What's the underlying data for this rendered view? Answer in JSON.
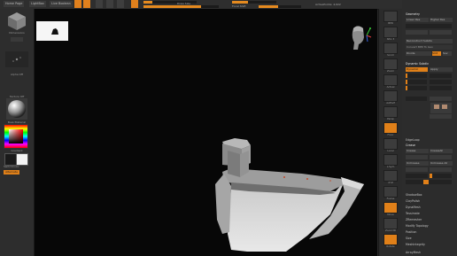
{
  "topbar": {
    "home_page": "Home Page",
    "lightbox": "LightBox",
    "live_boolean": "Live Boolean",
    "draw_size": "Draw Size",
    "focal_shift": "Focal Shift",
    "active_points": "ActivePoints: 4,622"
  },
  "left": {
    "cube_label": "Dimensions",
    "stroke_label": "AdCustom",
    "alpha_label": "Alpha Off",
    "material_label": "BasicMaterial",
    "texture_label": "Texture Off",
    "gradient_label": "Gradient",
    "switch_color": "SwitchColor",
    "alternate": "Alternate"
  },
  "rightcol": {
    "icons": [
      {
        "name": "bpr-icon",
        "label": "BPR"
      },
      {
        "name": "spix-icon",
        "label": "SPix 3"
      },
      {
        "name": "scroll-icon",
        "label": "Scroll"
      },
      {
        "name": "zoom-icon",
        "label": "Zoom"
      },
      {
        "name": "actual-icon",
        "label": "Actual"
      },
      {
        "name": "aahalf-icon",
        "label": "AAHalf"
      },
      {
        "name": "persp-icon",
        "label": "Persp"
      },
      {
        "name": "floor-icon",
        "label": "Floor"
      },
      {
        "name": "local-icon",
        "label": "Local"
      },
      {
        "name": "lsym-icon",
        "label": "L.Sym"
      },
      {
        "name": "xyz-icon",
        "label": "XYZ"
      },
      {
        "name": "frame-icon",
        "label": "Frame"
      },
      {
        "name": "move-icon",
        "label": "Move"
      },
      {
        "name": "zoom3d-icon",
        "label": "Zoom3D"
      },
      {
        "name": "rotate-icon",
        "label": "Rotate"
      },
      {
        "name": "linefill-icon",
        "label": "Line Fill PolyF"
      },
      {
        "name": "transp-icon",
        "label": "Transp"
      },
      {
        "name": "ghost-icon",
        "label": "Ghost"
      },
      {
        "name": "solo-icon",
        "label": "Solo"
      },
      {
        "name": "xpose-icon",
        "label": "Xpose"
      }
    ]
  },
  "rightpanel": {
    "geometry": "Geometry",
    "lower_res": "Lower Res",
    "higher_res": "Higher Res",
    "sdiv": "SDiv",
    "del_lower": "Del Lower",
    "del_higher": "Del Higher",
    "reconstruct_subdiv": "Reconstruct Subdiv",
    "convert_bpr": "Convert BPR To Geo",
    "divide": "Divide",
    "smt": "Smt",
    "suv": "Suv",
    "dynamic_subdiv": "Dynamic Subdiv",
    "dynamic": "Dynamic",
    "apply": "Apply",
    "qgrid": "QGrid 0",
    "coverage": "Coverage",
    "flat_subdiv": "Flat Subdiv",
    "smooth_subdiv": "Smooth Subdiv",
    "micropoly": "MicroPoly Off",
    "edgeloop": "EdgeLoop",
    "crease": "Crease",
    "crease_all": "CreaseAll",
    "crease_pg": "Crease PG",
    "uncrease_all": "UnCrease All",
    "uncrease": "UnCrease",
    "crease_lvl": "Crease Lvl 15",
    "shadowbox": "ShadowBox",
    "claypolish": "ClayPolish",
    "dynamesh": "DynaMesh",
    "tessimate": "Tessimate",
    "zremesher": "ZRemesher",
    "modify_topology": "Modify Topology",
    "position": "Position",
    "size": "Size",
    "meshintegrity": "MeshIntegrity",
    "arraymesh": "ArrayMesh"
  },
  "colors": {
    "accent": "#e08019",
    "canvas": "#070707",
    "panel": "#2c2c2c"
  }
}
